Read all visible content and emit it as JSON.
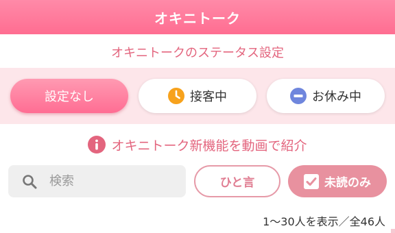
{
  "header": {
    "title": "オキニトーク"
  },
  "subtitle": "オキニトークのステータス設定",
  "status_options": [
    {
      "label": "設定なし",
      "icon": "none",
      "selected": true
    },
    {
      "label": "接客中",
      "icon": "clock-icon",
      "color": "#f7a21c"
    },
    {
      "label": "お休み中",
      "icon": "minus-circle-icon",
      "color": "#6f86dd"
    }
  ],
  "promo": {
    "label": "オキニトーク新機能を動画で紹介",
    "icon": "info-icon",
    "color": "#e3657e"
  },
  "search": {
    "placeholder": "検索",
    "value": ""
  },
  "filters": {
    "hitokoto_label": "ひと言",
    "unread_label": "未読のみ",
    "unread_checked": true
  },
  "result_count": "1〜30人を表示／全46人",
  "colors": {
    "accent": "#ff6d91",
    "accent_text": "#e3657e",
    "status_bg": "#fde6ea"
  }
}
